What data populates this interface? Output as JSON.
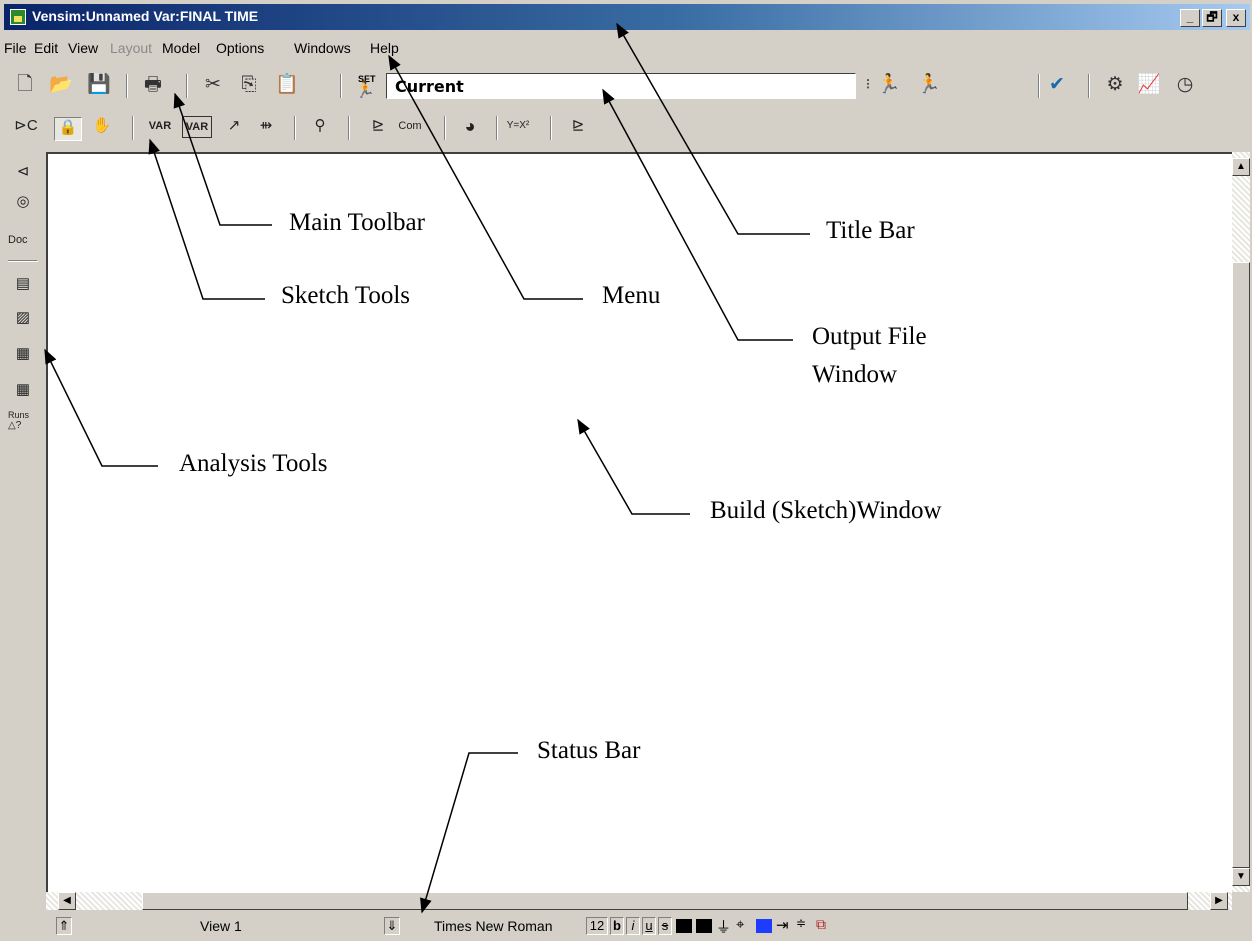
{
  "window": {
    "title": "Vensim:Unnamed Var:FINAL TIME",
    "caption_buttons": [
      "_",
      "🗗",
      "x"
    ]
  },
  "menu": [
    {
      "label": "File",
      "enabled": true
    },
    {
      "label": "Edit",
      "enabled": true
    },
    {
      "label": "View",
      "enabled": true
    },
    {
      "label": "Layout",
      "enabled": false
    },
    {
      "label": "Model",
      "enabled": true
    },
    {
      "label": "Options",
      "enabled": true
    },
    {
      "label": "Windows",
      "enabled": true
    },
    {
      "label": "Help",
      "enabled": true
    }
  ],
  "toolbar": {
    "set_label": "SET",
    "output_file": "Current"
  },
  "left_tools": {
    "doc_label": "Doc",
    "runs_label": "Runs",
    "runs_sub": "△?"
  },
  "sketch_tools": {
    "var_label": "VAR",
    "com_label": "Com",
    "eq_label": "Y=X²"
  },
  "statusbar": {
    "view": "View 1",
    "font": "Times New Roman",
    "size": "12",
    "bold": "b",
    "italic": "i",
    "underline": "u",
    "strike": "s"
  },
  "annotations": {
    "title_bar": "Title Bar",
    "main_toolbar": "Main Toolbar",
    "sketch_tools": "Sketch Tools",
    "menu": "Menu",
    "output_file": "Output File",
    "output_window": "Window",
    "analysis_tools": "Analysis Tools",
    "build_window": "Build (Sketch)Window",
    "status_bar": "Status Bar"
  },
  "colors": {
    "title_start": "#0a246a",
    "chrome": "#d4d0c8",
    "swatch_blue": "#1e3cff"
  }
}
